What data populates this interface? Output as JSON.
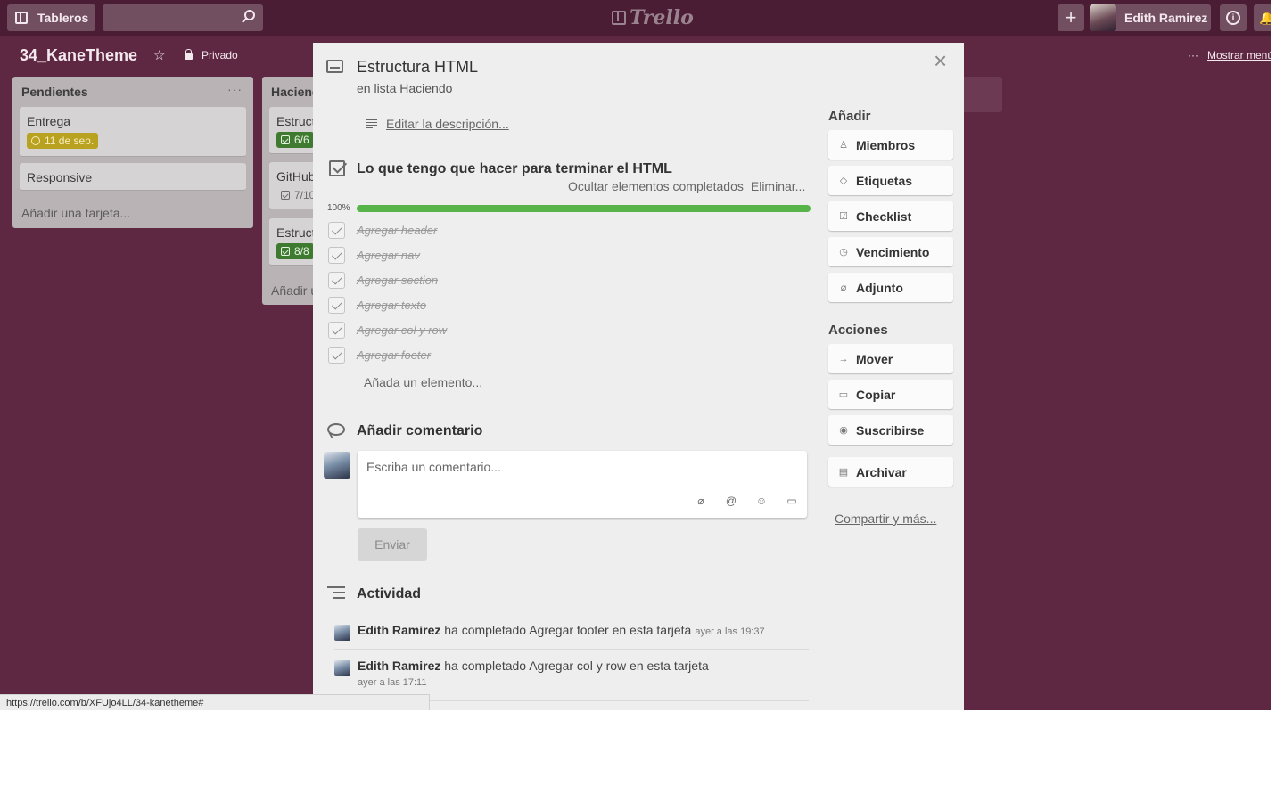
{
  "header": {
    "boards_label": "Tableros",
    "logo_text": "Trello",
    "add_label": "+",
    "user_name": "Edith Ramirez",
    "info_label": "i"
  },
  "board": {
    "title": "34_KaneTheme",
    "visibility": "Privado",
    "menu_dots": "···",
    "menu_label": "Mostrar menú"
  },
  "lists": [
    {
      "title": "Pendientes",
      "menu": "···",
      "cards": [
        {
          "title": "Entrega",
          "badge": "11 de sep."
        },
        {
          "title": "Responsive"
        }
      ],
      "add_card": "Añadir una tarjeta..."
    },
    {
      "title": "Haciendo",
      "cards": [
        {
          "title": "Estructura HTML",
          "badge": "6/6"
        },
        {
          "title": "GitHub",
          "badge": "7/10"
        },
        {
          "title": "Estructura CSS",
          "badge": "8/8"
        }
      ],
      "add_card": "Añadir una tarjeta..."
    }
  ],
  "modal": {
    "title": "Estructura HTML",
    "in_list_prefix": "en lista",
    "list_name": "Haciendo",
    "edit_description": "Editar la descripción...",
    "close": "×",
    "checklist": {
      "title": "Lo que tengo que hacer para terminar el HTML",
      "hide_completed": "Ocultar elementos completados",
      "delete": "Eliminar...",
      "progress_label": "100%",
      "progress": 1.0,
      "items": [
        {
          "text": "Agregar header",
          "done": true
        },
        {
          "text": "Agregar nav",
          "done": true
        },
        {
          "text": "Agregar section",
          "done": true
        },
        {
          "text": "Agregar texto",
          "done": true
        },
        {
          "text": "Agregar col y row",
          "done": true
        },
        {
          "text": "Agregar footer",
          "done": true
        }
      ],
      "add_item": "Añada un elemento..."
    },
    "comment": {
      "title": "Añadir comentario",
      "placeholder": "Escriba un comentario...",
      "send": "Enviar"
    },
    "activity": {
      "title": "Actividad",
      "entries": [
        {
          "user": "Edith Ramirez",
          "text": "ha completado Agregar footer en esta tarjeta",
          "time": "ayer a las 19:37"
        },
        {
          "user": "Edith Ramirez",
          "text": "ha completado Agregar col y row en esta tarjeta",
          "time": "ayer a las 17:11"
        }
      ]
    },
    "sidebar": {
      "add_title": "Añadir",
      "add_buttons": [
        "Miembros",
        "Etiquetas",
        "Checklist",
        "Vencimiento",
        "Adjunto"
      ],
      "actions_title": "Acciones",
      "action_buttons": [
        "Mover",
        "Copiar",
        "Suscribirse"
      ],
      "archive": "Archivar",
      "share": "Compartir y más..."
    }
  },
  "status_url": "https://trello.com/b/XFUjo4LL/34-kanetheme#",
  "colors": {
    "board_bg": "#5e2742",
    "progress_fill": "#57b449",
    "date_badge": "#b9a21f",
    "checklist_badge": "#3f7a31"
  }
}
